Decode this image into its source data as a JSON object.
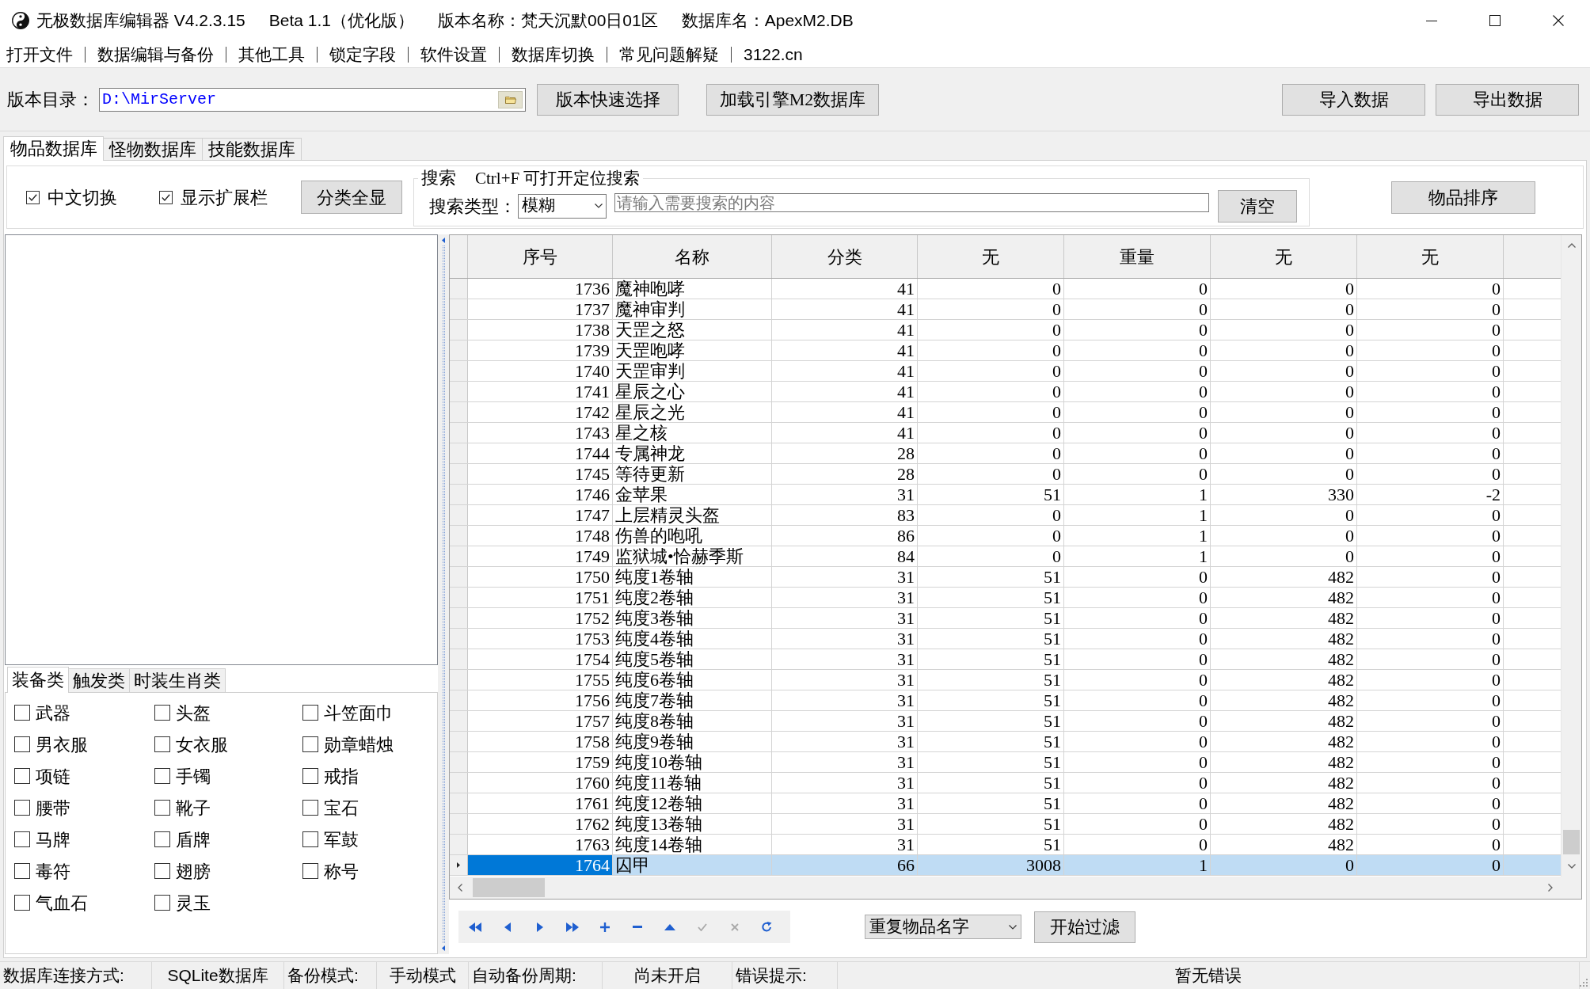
{
  "window": {
    "title_parts": [
      "无极数据库编辑器 V4.2.3.15",
      "Beta 1.1（优化版）",
      "版本名称：梵天沉默00日01区",
      "数据库名：ApexM2.DB"
    ]
  },
  "menu": [
    "打开文件",
    "数据编辑与备份",
    "其他工具",
    "锁定字段",
    "软件设置",
    "数据库切换",
    "常见问题解疑",
    "3122.cn"
  ],
  "toolbar": {
    "path_label": "版本目录：",
    "path_value": "D:\\MirServer",
    "buttons": [
      "版本快速选择",
      "加载引擎M2数据库"
    ],
    "right_buttons": [
      "导入数据",
      "导出数据"
    ]
  },
  "main_tabs": [
    {
      "label": "物品数据库",
      "selected": true
    },
    {
      "label": "怪物数据库",
      "selected": false
    },
    {
      "label": "技能数据库",
      "selected": false
    }
  ],
  "options": {
    "checkboxes": [
      {
        "label": "中文切换",
        "checked": true
      },
      {
        "label": "显示扩展栏",
        "checked": true
      }
    ],
    "show_all_button": "分类全显"
  },
  "search": {
    "group_title": "搜索",
    "hint": "Ctrl+F 可打开定位搜索",
    "type_label": "搜索类型：",
    "type_value": "模糊",
    "placeholder": "请输入需要搜索的内容",
    "clear_button": "清空"
  },
  "sort_button": "物品排序",
  "category_tabs": [
    {
      "label": "装备类",
      "selected": true
    },
    {
      "label": "触发类",
      "selected": false
    },
    {
      "label": "时装生肖类",
      "selected": false
    }
  ],
  "categories": [
    {
      "label": "武器",
      "checked": false
    },
    {
      "label": "头盔",
      "checked": false
    },
    {
      "label": "斗笠面巾",
      "checked": false
    },
    {
      "label": "男衣服",
      "checked": false
    },
    {
      "label": "女衣服",
      "checked": false
    },
    {
      "label": "勋章蜡烛",
      "checked": false
    },
    {
      "label": "项链",
      "checked": false
    },
    {
      "label": "手镯",
      "checked": false
    },
    {
      "label": "戒指",
      "checked": false
    },
    {
      "label": "腰带",
      "checked": false
    },
    {
      "label": "靴子",
      "checked": false
    },
    {
      "label": "宝石",
      "checked": false
    },
    {
      "label": "马牌",
      "checked": false
    },
    {
      "label": "盾牌",
      "checked": false
    },
    {
      "label": "军鼓",
      "checked": false
    },
    {
      "label": "毒符",
      "checked": false
    },
    {
      "label": "翅膀",
      "checked": false
    },
    {
      "label": "称号",
      "checked": false
    },
    {
      "label": "气血石",
      "checked": false
    },
    {
      "label": "灵玉",
      "checked": false
    }
  ],
  "table": {
    "columns": [
      "序号",
      "名称",
      "分类",
      "无",
      "重量",
      "无",
      "无"
    ],
    "rows": [
      {
        "cells": [
          "1736",
          "魔神咆哮",
          "41",
          "0",
          "0",
          "0",
          "0"
        ],
        "selected": false
      },
      {
        "cells": [
          "1737",
          "魔神审判",
          "41",
          "0",
          "0",
          "0",
          "0"
        ],
        "selected": false
      },
      {
        "cells": [
          "1738",
          "天罡之怒",
          "41",
          "0",
          "0",
          "0",
          "0"
        ],
        "selected": false
      },
      {
        "cells": [
          "1739",
          "天罡咆哮",
          "41",
          "0",
          "0",
          "0",
          "0"
        ],
        "selected": false
      },
      {
        "cells": [
          "1740",
          "天罡审判",
          "41",
          "0",
          "0",
          "0",
          "0"
        ],
        "selected": false
      },
      {
        "cells": [
          "1741",
          "星辰之心",
          "41",
          "0",
          "0",
          "0",
          "0"
        ],
        "selected": false
      },
      {
        "cells": [
          "1742",
          "星辰之光",
          "41",
          "0",
          "0",
          "0",
          "0"
        ],
        "selected": false
      },
      {
        "cells": [
          "1743",
          "星之核",
          "41",
          "0",
          "0",
          "0",
          "0"
        ],
        "selected": false
      },
      {
        "cells": [
          "1744",
          "专属神龙",
          "28",
          "0",
          "0",
          "0",
          "0"
        ],
        "selected": false
      },
      {
        "cells": [
          "1745",
          "等待更新",
          "28",
          "0",
          "0",
          "0",
          "0"
        ],
        "selected": false
      },
      {
        "cells": [
          "1746",
          "金苹果",
          "31",
          "51",
          "1",
          "330",
          "-2"
        ],
        "selected": false
      },
      {
        "cells": [
          "1747",
          "上层精灵头盔",
          "83",
          "0",
          "1",
          "0",
          "0"
        ],
        "selected": false
      },
      {
        "cells": [
          "1748",
          "伤兽的咆吼",
          "86",
          "0",
          "1",
          "0",
          "0"
        ],
        "selected": false
      },
      {
        "cells": [
          "1749",
          "监狱城•恰赫季斯",
          "84",
          "0",
          "1",
          "0",
          "0"
        ],
        "selected": false
      },
      {
        "cells": [
          "1750",
          "纯度1卷轴",
          "31",
          "51",
          "0",
          "482",
          "0"
        ],
        "selected": false
      },
      {
        "cells": [
          "1751",
          "纯度2卷轴",
          "31",
          "51",
          "0",
          "482",
          "0"
        ],
        "selected": false
      },
      {
        "cells": [
          "1752",
          "纯度3卷轴",
          "31",
          "51",
          "0",
          "482",
          "0"
        ],
        "selected": false
      },
      {
        "cells": [
          "1753",
          "纯度4卷轴",
          "31",
          "51",
          "0",
          "482",
          "0"
        ],
        "selected": false
      },
      {
        "cells": [
          "1754",
          "纯度5卷轴",
          "31",
          "51",
          "0",
          "482",
          "0"
        ],
        "selected": false
      },
      {
        "cells": [
          "1755",
          "纯度6卷轴",
          "31",
          "51",
          "0",
          "482",
          "0"
        ],
        "selected": false
      },
      {
        "cells": [
          "1756",
          "纯度7卷轴",
          "31",
          "51",
          "0",
          "482",
          "0"
        ],
        "selected": false
      },
      {
        "cells": [
          "1757",
          "纯度8卷轴",
          "31",
          "51",
          "0",
          "482",
          "0"
        ],
        "selected": false
      },
      {
        "cells": [
          "1758",
          "纯度9卷轴",
          "31",
          "51",
          "0",
          "482",
          "0"
        ],
        "selected": false
      },
      {
        "cells": [
          "1759",
          "纯度10卷轴",
          "31",
          "51",
          "0",
          "482",
          "0"
        ],
        "selected": false
      },
      {
        "cells": [
          "1760",
          "纯度11卷轴",
          "31",
          "51",
          "0",
          "482",
          "0"
        ],
        "selected": false
      },
      {
        "cells": [
          "1761",
          "纯度12卷轴",
          "31",
          "51",
          "0",
          "482",
          "0"
        ],
        "selected": false
      },
      {
        "cells": [
          "1762",
          "纯度13卷轴",
          "31",
          "51",
          "0",
          "482",
          "0"
        ],
        "selected": false
      },
      {
        "cells": [
          "1763",
          "纯度14卷轴",
          "31",
          "51",
          "0",
          "482",
          "0"
        ],
        "selected": false
      },
      {
        "cells": [
          "1764",
          "囚甲",
          "66",
          "3008",
          "1",
          "0",
          "0"
        ],
        "selected": true
      }
    ]
  },
  "navigator": [
    {
      "kind": "first",
      "disabled": false
    },
    {
      "kind": "prior",
      "disabled": false
    },
    {
      "kind": "next",
      "disabled": false
    },
    {
      "kind": "last",
      "disabled": false
    },
    {
      "kind": "insert",
      "disabled": false
    },
    {
      "kind": "delete",
      "disabled": false
    },
    {
      "kind": "edit",
      "disabled": false
    },
    {
      "kind": "post",
      "disabled": true
    },
    {
      "kind": "cancel",
      "disabled": true
    },
    {
      "kind": "refresh",
      "disabled": false
    }
  ],
  "filter": {
    "value": "重复物品名字",
    "button": "开始过滤"
  },
  "status_bar": [
    {
      "kind": "label",
      "text": "数据库连接方式:"
    },
    {
      "kind": "value",
      "text": "SQLite数据库"
    },
    {
      "kind": "label",
      "text": "备份模式:"
    },
    {
      "kind": "value",
      "text": "手动模式"
    },
    {
      "kind": "label",
      "text": "自动备份周期:"
    },
    {
      "kind": "value",
      "text": "尚未开启"
    },
    {
      "kind": "label",
      "text": "错误提示:"
    },
    {
      "kind": "value",
      "text": "暂无错误"
    }
  ]
}
